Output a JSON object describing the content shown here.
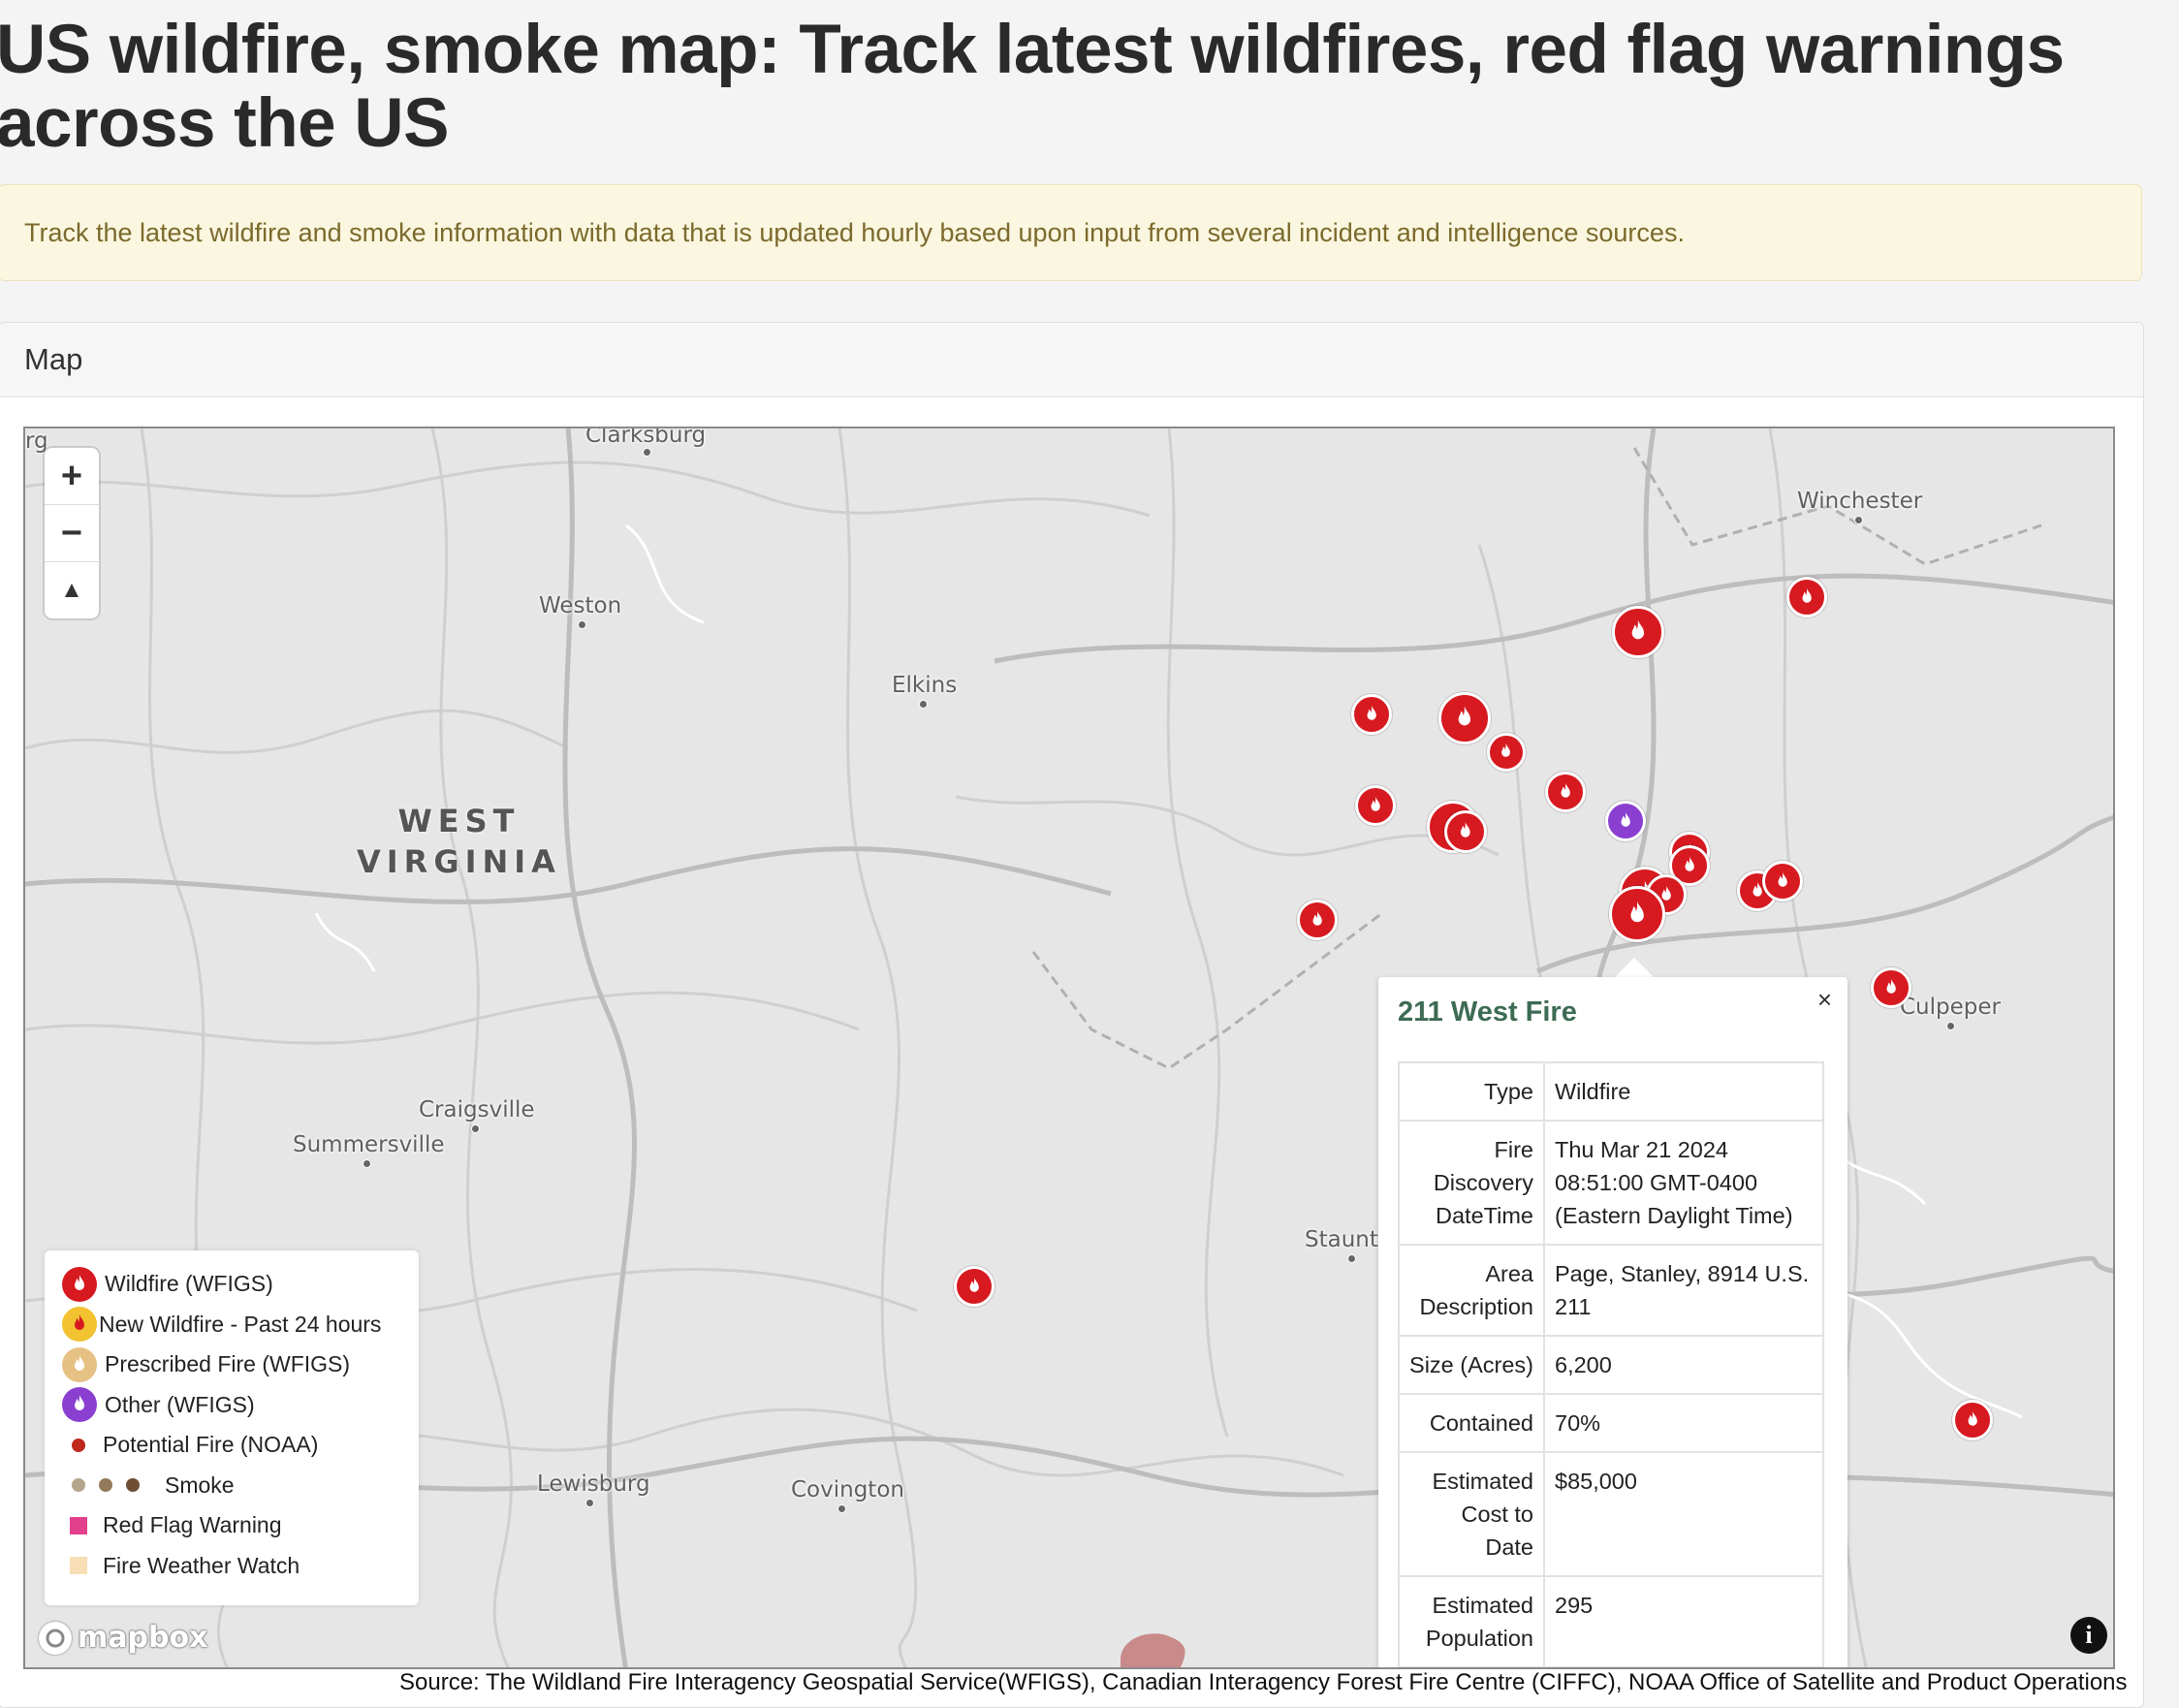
{
  "title": "US wildfire, smoke map: Track latest wildfires, red flag warnings across the US",
  "banner": "Track the latest wildfire and smoke information with data that is updated hourly based upon input from several incident and intelligence sources.",
  "card_header": "Map",
  "map": {
    "state_label_1": "WEST",
    "state_label_2": "VIRGINIA",
    "places": {
      "clarksburg": "Clarksburg",
      "weston": "Weston",
      "elkins": "Elkins",
      "winchester": "Winchester",
      "culpeper": "Culpeper",
      "craigsville": "Craigsville",
      "summersville": "Summersville",
      "staunton": "Staunt",
      "lewisburg": "Lewisburg",
      "covington": "Covington",
      "edge_left": "rg"
    },
    "zoom_in": "+",
    "zoom_out": "−",
    "compass": "▲",
    "attribution_logo": "mapbox",
    "info_button": "i",
    "marker_colors": {
      "wildfire": "#d71920",
      "other": "#8a3fd1"
    }
  },
  "legend": {
    "items": [
      {
        "label": "Wildfire (WFIGS)",
        "color": "#d71920"
      },
      {
        "label": "New Wildfire - Past 24 hours",
        "color": "#f2c230"
      },
      {
        "label": "Prescribed Fire (WFIGS)",
        "color": "#e6c184"
      },
      {
        "label": "Other (WFIGS)",
        "color": "#8a3fd1"
      },
      {
        "label": "Potential Fire (NOAA)",
        "color": "#c0271d"
      },
      {
        "label": "Smoke",
        "colors": [
          "#b4a58c",
          "#947a5c",
          "#6e4f35"
        ]
      },
      {
        "label": "Red Flag Warning",
        "color": "#e23f8c"
      },
      {
        "label": "Fire Weather Watch",
        "color": "#f7deb4"
      }
    ]
  },
  "popup": {
    "title": "211 West Fire",
    "close": "×",
    "rows": [
      {
        "key": "Type",
        "value": "Wildfire"
      },
      {
        "key": "Fire Discovery DateTime",
        "value": "Thu Mar 21 2024 08:51:00 GMT-0400 (Eastern Daylight Time)"
      },
      {
        "key": "Area Description",
        "value": "Page, Stanley, 8914 U.S. 211"
      },
      {
        "key": "Size (Acres)",
        "value": "6,200"
      },
      {
        "key": "Contained",
        "value": "70%"
      },
      {
        "key": "Estimated Cost to Date",
        "value": "$85,000"
      },
      {
        "key": "Estimated Population",
        "value": "295"
      }
    ]
  },
  "source": "Source: The Wildland Fire Interagency Geospatial Service(WFIGS), Canadian Interagency Forest Fire Centre (CIFFC), NOAA Office of Satellite and Product Operations"
}
